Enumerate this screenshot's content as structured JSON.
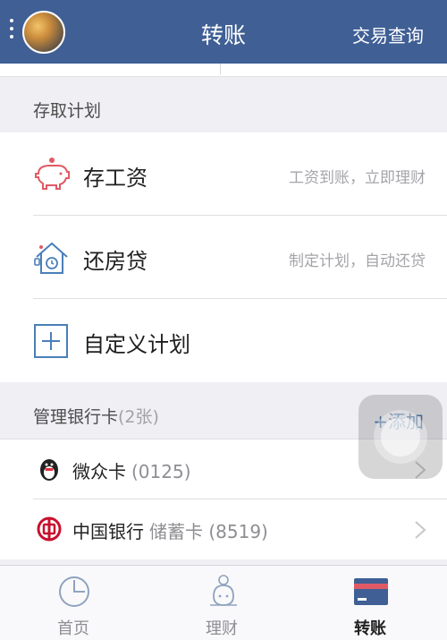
{
  "navbar": {
    "title": "转账",
    "right_action": "交易查询"
  },
  "plans_section": {
    "title": "存取计划",
    "items": [
      {
        "label": "存工资",
        "hint": "工资到账，立即理财",
        "icon": "piggy-bank-icon"
      },
      {
        "label": "还房贷",
        "hint": "制定计划，自动还贷",
        "icon": "house-clock-icon"
      },
      {
        "label": "自定义计划",
        "hint": "",
        "icon": "plus-box-icon"
      }
    ]
  },
  "cards_section": {
    "title": "管理银行卡",
    "count": "(2张)",
    "add_label": "+添加",
    "cards": [
      {
        "name": "微众卡",
        "sub": "(0125)",
        "icon": "penguin-icon"
      },
      {
        "name": "中国银行",
        "sub": "储蓄卡 (8519)",
        "icon": "bank-of-china-icon"
      }
    ]
  },
  "tabs": [
    {
      "label": "首页",
      "icon": "clock-pie-icon",
      "active": false
    },
    {
      "label": "理财",
      "icon": "money-bag-icon",
      "active": false
    },
    {
      "label": "转账",
      "icon": "bank-card-icon",
      "active": true
    }
  ],
  "colors": {
    "navbar_bg": "#3f5f95",
    "link_blue": "#3b6ea6",
    "icon_accent": "#e05a65",
    "icon_blue": "#4a7fb8"
  }
}
